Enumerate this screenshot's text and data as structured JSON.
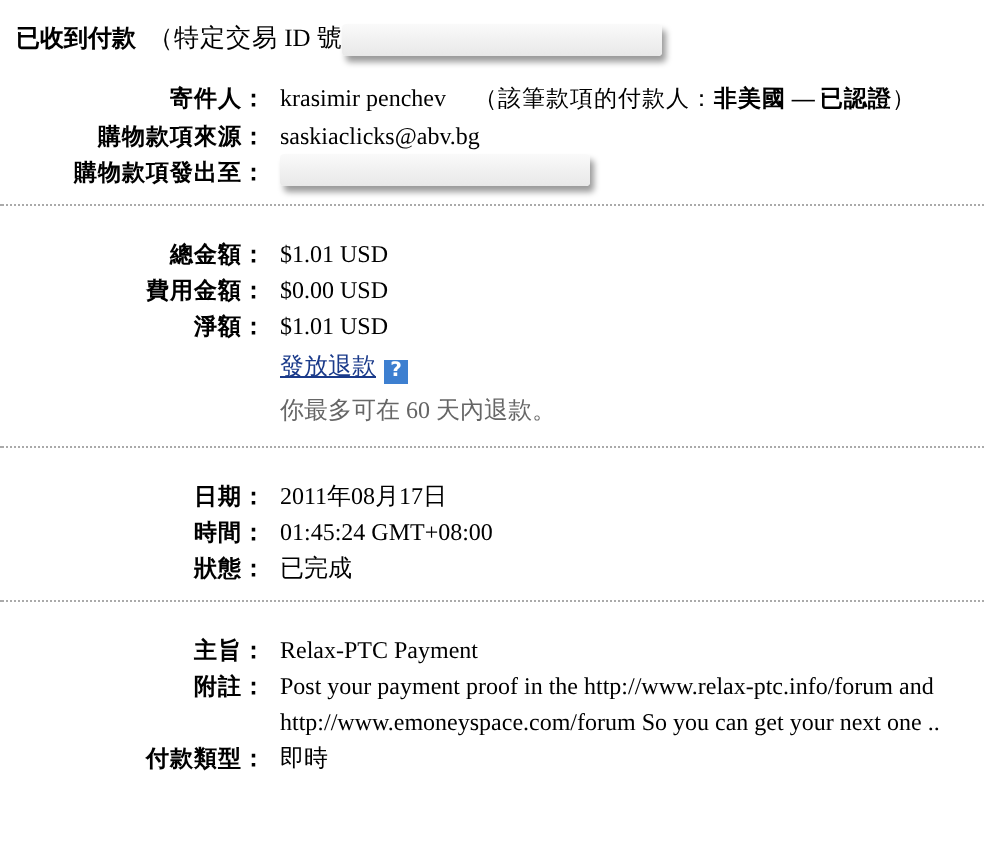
{
  "header": {
    "title": "已收到付款",
    "subtitle": "（特定交易 ID 號",
    "redacted": true
  },
  "sections": [
    {
      "rows": [
        {
          "kind": "text",
          "label": "寄件人：",
          "value": "krasimir penchev",
          "note": "（該筆款項的付款人：**非美國 — 已認證**）"
        },
        {
          "kind": "text",
          "label": "購物款項來源：",
          "value": "saskiaclicks@abv.bg"
        },
        {
          "kind": "redacted",
          "label": "購物款項發出至："
        }
      ]
    },
    {
      "rows": [
        {
          "kind": "text",
          "label": "總金額：",
          "value": "$1.01 USD"
        },
        {
          "kind": "text",
          "label": "費用金額：",
          "value": "$0.00 USD"
        },
        {
          "kind": "text",
          "label": "淨額：",
          "value": "$1.01 USD"
        },
        {
          "kind": "link",
          "value": "發放退款",
          "icon": "?"
        },
        {
          "kind": "hint",
          "value": "你最多可在 60 天內退款。"
        }
      ]
    },
    {
      "rows": [
        {
          "kind": "text",
          "label": "日期：",
          "value": "2011年08月17日"
        },
        {
          "kind": "text",
          "label": "時間：",
          "value": "01:45:24 GMT+08:00"
        },
        {
          "kind": "text",
          "label": "狀態：",
          "value": "已完成"
        }
      ]
    },
    {
      "rows": [
        {
          "kind": "text",
          "label": "主旨：",
          "value": "Relax-PTC Payment"
        },
        {
          "kind": "text",
          "label": "附註：",
          "value": "Post your payment proof in the http://www.relax-ptc.info/forum and http://www.emoneyspace.com/forum So you can get your next one .."
        },
        {
          "kind": "text",
          "label": "付款類型：",
          "value": "即時"
        }
      ]
    }
  ]
}
